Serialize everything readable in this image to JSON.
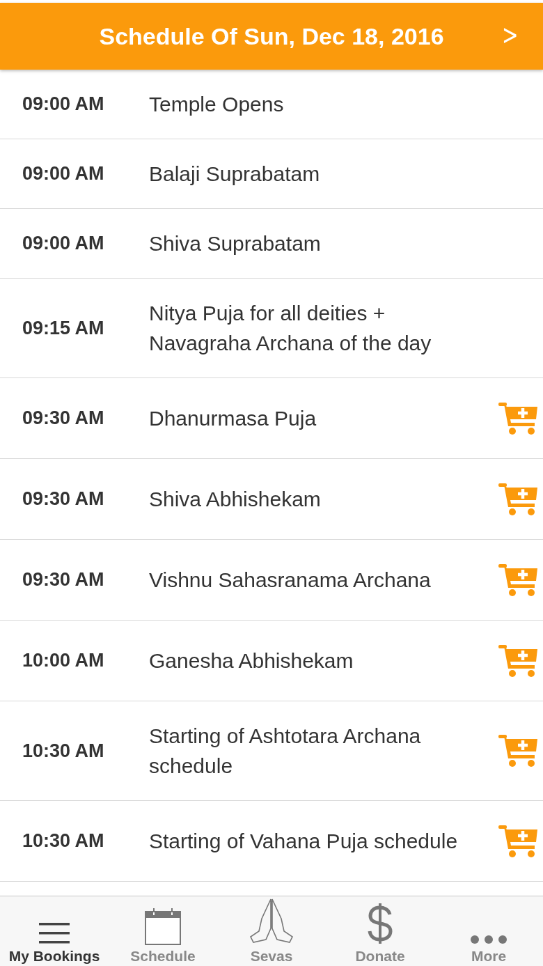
{
  "header": {
    "title": "Schedule Of Sun, Dec 18, 2016",
    "next_button": ">"
  },
  "events": [
    {
      "time": "09:00 AM",
      "title": "Temple Opens",
      "bookable": false
    },
    {
      "time": "09:00 AM",
      "title": "Balaji Suprabatam",
      "bookable": false
    },
    {
      "time": "09:00 AM",
      "title": "Shiva Suprabatam",
      "bookable": false
    },
    {
      "time": "09:15 AM",
      "title": "Nitya Puja for all deities + Navagraha Archana of the day",
      "bookable": false
    },
    {
      "time": "09:30 AM",
      "title": "Dhanurmasa Puja",
      "bookable": true
    },
    {
      "time": "09:30 AM",
      "title": "Shiva Abhishekam",
      "bookable": true
    },
    {
      "time": "09:30 AM",
      "title": "Vishnu Sahasranama Archana",
      "bookable": true
    },
    {
      "time": "10:00 AM",
      "title": "Ganesha Abhishekam",
      "bookable": true
    },
    {
      "time": "10:30 AM",
      "title": "Starting of Ashtotara Archana schedule",
      "bookable": true
    },
    {
      "time": "10:30 AM",
      "title": "Starting of Vahana Puja schedule",
      "bookable": true
    }
  ],
  "tab_bar": [
    {
      "label": "My Bookings",
      "kind": "menu",
      "selected": true
    },
    {
      "label": "Schedule",
      "kind": "calendar",
      "selected": false
    },
    {
      "label": "Sevas",
      "kind": "hands",
      "selected": false
    },
    {
      "label": "Donate",
      "kind": "dollar",
      "selected": false
    },
    {
      "label": "More",
      "kind": "dots",
      "selected": false
    }
  ]
}
